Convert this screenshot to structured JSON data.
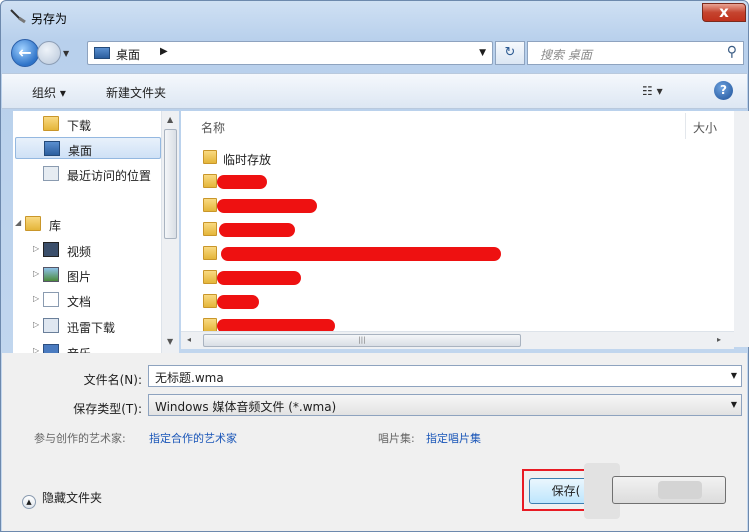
{
  "window": {
    "title": "另存为",
    "close_glyph": "x"
  },
  "nav": {
    "back_glyph": "←",
    "breadcrumb": "桌面",
    "crumb_arrow": "▶",
    "refresh_glyph": "↻",
    "search_placeholder": "搜索 桌面",
    "search_glyph": "⚲"
  },
  "toolbar": {
    "organize": "组织 ▾",
    "new_folder": "新建文件夹",
    "view": "☷ ▾",
    "help": "?"
  },
  "sidebar": {
    "items": [
      {
        "label": "下载",
        "icon": "download-folder-icon"
      },
      {
        "label": "桌面",
        "icon": "desktop-icon",
        "selected": true
      },
      {
        "label": "最近访问的位置",
        "icon": "recent-places-icon"
      },
      {
        "label": "库",
        "icon": "library-icon"
      },
      {
        "label": "视频",
        "icon": "video-library-icon"
      },
      {
        "label": "图片",
        "icon": "pictures-library-icon"
      },
      {
        "label": "文档",
        "icon": "documents-library-icon"
      },
      {
        "label": "迅雷下载",
        "icon": "thunder-download-icon"
      },
      {
        "label": "音乐",
        "icon": "music-library-icon"
      }
    ]
  },
  "files": {
    "col_name": "名称",
    "col_size": "大小",
    "temp_item": "临时存放"
  },
  "form": {
    "filename_label": "文件名(N):",
    "filename_value": "无标题.wma",
    "filetype_label": "保存类型(T):",
    "filetype_value": "Windows 媒体音频文件 (*.wma)",
    "artist_label": "参与创作的艺术家:",
    "artist_value": "指定合作的艺术家",
    "album_label": "唱片集:",
    "album_value": "指定唱片集",
    "hide_folders": "隐藏文件夹",
    "save": "保存(",
    "dropdown_glyph": "▼"
  }
}
